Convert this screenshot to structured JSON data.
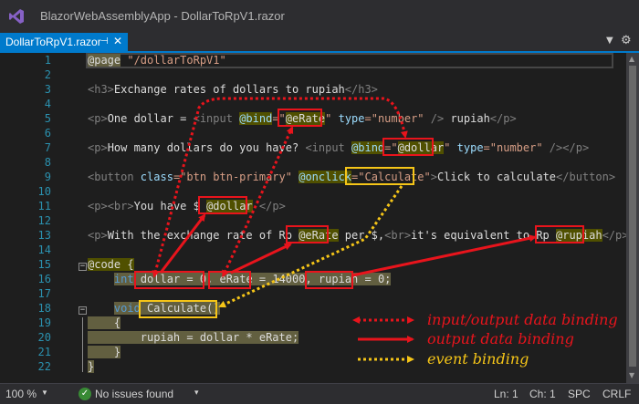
{
  "window": {
    "title": "BlazorWebAssemblyApp - DollarToRpV1.razor"
  },
  "tab": {
    "label": "DollarToRpV1.razor",
    "pin_glyph": "⊣",
    "close_glyph": "✕",
    "dropdown_glyph": "▼",
    "settings_glyph": "⚙"
  },
  "colors": {
    "input_output": "#e8141c",
    "output": "#e8141c",
    "event": "#f5c518",
    "tag": "#569cd6",
    "attr": "#9cdcfe",
    "string": "#d69d85",
    "keyword": "#569cd6",
    "text": "#dcdcdc"
  },
  "line_numbers": [
    "1",
    "2",
    "3",
    "4",
    "5",
    "6",
    "7",
    "8",
    "9",
    "10",
    "11",
    "12",
    "13",
    "14",
    "15",
    "16",
    "17",
    "18",
    "19",
    "20",
    "21",
    "22"
  ],
  "code": {
    "l1": {
      "directive": "@page",
      "text": " \"/dollarToRpV1\""
    },
    "l3": {
      "open": "<h3>",
      "text": "Exchange rates of dollars to rupiah",
      "close": "</h3>"
    },
    "l5": {
      "p1": "<p>",
      "t1": "One dollar = ",
      "tag": "<input",
      "sp": " ",
      "bind": "@bind",
      "eq": "=\"",
      "var": "@eRate",
      "q": "\"",
      "attr": " type",
      "val": "=\"number\"",
      "end": " />",
      "t2": " rupiah",
      "pclose": "</p>"
    },
    "l7": {
      "p1": "<p>",
      "t1": "How many dollars do you have? ",
      "tag": "<input",
      "sp": " ",
      "bind": "@bind",
      "eq": "=\"",
      "var": "@dollar",
      "q": "\"",
      "attr": " type",
      "val": "=\"number\"",
      "end": " />",
      "pclose": "</p>"
    },
    "l9": {
      "tag": "<button",
      "attr": " class",
      "val": "=\"btn btn-primary\"",
      "sp": " ",
      "onclick": "@onclick",
      "eq": "=",
      "handler": "\"Calculate\"",
      "gt": ">",
      "text": "Click to calculate",
      "close": "</button>"
    },
    "l11": {
      "p1": "<p>",
      "br": "<br>",
      "t1": "You have $ ",
      "var": "@dollar",
      "sp": " ",
      "pclose": "</p>"
    },
    "l13": {
      "p1": "<p>",
      "t1": "With the exchange rate of Rp ",
      "var": "@eRate",
      "t2": " per $,",
      "br": "<br>",
      "t3": "it's equivalent to Rp ",
      "var2": "@rupiah",
      "pclose": "</p>"
    },
    "l15": {
      "directive": "@code",
      "brace": " {"
    },
    "l16": {
      "indent": "    ",
      "kw": "int",
      "sp": " ",
      "v1": "dollar",
      "a1": " = 0, ",
      "v2": "eRate",
      "a2": " = 14000, ",
      "v3": "rupiah",
      "a3": " = 0;"
    },
    "l18": {
      "indent": "    ",
      "kw": "void",
      "sp": " ",
      "fn": "Calculate()"
    },
    "l19": {
      "text": "    {"
    },
    "l20": {
      "text": "        rupiah = dollar * eRate;"
    },
    "l21": {
      "text": "    }"
    },
    "l22": {
      "text": "}"
    }
  },
  "legend": {
    "input_output": "input/output data binding",
    "output": "output data binding",
    "event": "event binding"
  },
  "status": {
    "zoom": "100 %",
    "zoom_dropdown": "▼",
    "issues_icon": "✓",
    "issues": "No issues found",
    "issues_dropdown": "▾",
    "ln": "Ln: 1",
    "ch": "Ch: 1",
    "spc": "SPC",
    "crlf": "CRLF"
  },
  "scrollbar": {
    "up_glyph": "▲",
    "down_glyph": "▼"
  }
}
